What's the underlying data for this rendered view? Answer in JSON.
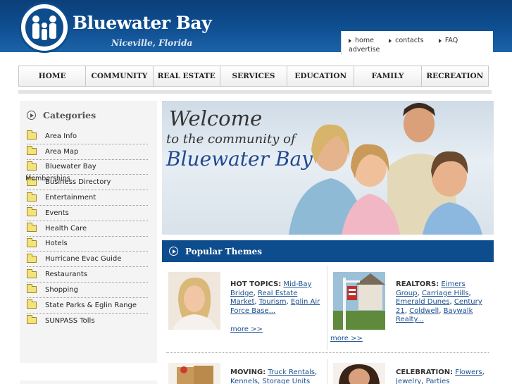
{
  "header": {
    "brand": "Bluewater Bay",
    "subtitle": "Niceville, Florida",
    "links": [
      "home",
      "contacts",
      "FAQ"
    ],
    "link_row2": "advertise"
  },
  "nav": [
    "HOME",
    "COMMUNITY",
    "REAL ESTATE",
    "SERVICES",
    "EDUCATION",
    "FAMILY",
    "RECREATION"
  ],
  "sidebar": {
    "title": "Categories",
    "items": [
      "Area Info",
      "Area Map",
      "Bluewater Bay",
      "Business Directory",
      "Entertainment",
      "Events",
      "Health Care",
      "Hotels",
      "Hurricane Evac Guide",
      "Restaurants",
      "Shopping",
      "State Parks & Eglin Range",
      "SUNPASS Tolls"
    ],
    "overlap_text": "Memberships"
  },
  "banner": {
    "line1": "Welcome",
    "line2": "to the community of",
    "line3": "Bluewater Bay"
  },
  "themes": {
    "title": "Popular Themes",
    "hot_topics": {
      "label": "HOT TOPICS:",
      "links": [
        "Mid-Bay Bridge",
        "Real Estate Market",
        "Tourism",
        "Eglin Air Force Base..."
      ],
      "more": "more >>"
    },
    "realtors": {
      "label": "REALTORS:",
      "links": [
        "Eimers Group",
        "Carriage Hills",
        "Emerald Dunes",
        "Century 21",
        "Coldwell",
        "Baywalk Realty..."
      ],
      "more": "more >>"
    },
    "moving": {
      "label": "MOVING:",
      "links": [
        "Truck Rentals",
        "Kennels",
        "Storage Units"
      ]
    },
    "celebration": {
      "label": "CELEBRATION:",
      "links": [
        "Flowers",
        "Jewelry",
        "Parties"
      ]
    }
  },
  "colors": {
    "header_blue": "#0d4d8e",
    "link_blue": "#1b4f8f"
  }
}
